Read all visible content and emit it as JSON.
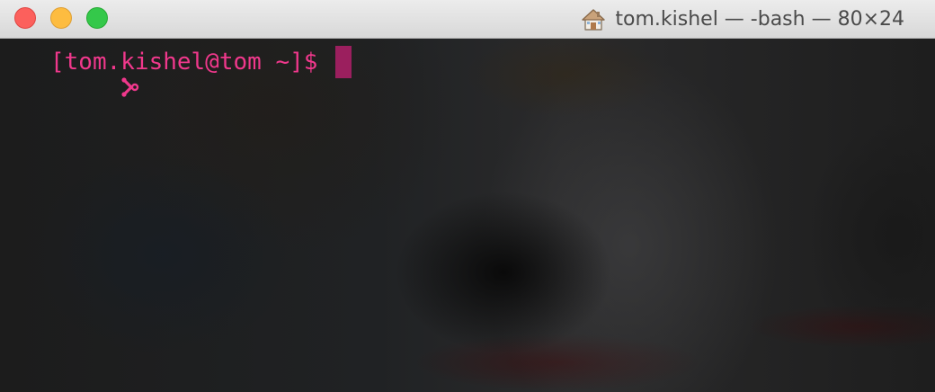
{
  "window": {
    "title": "tom.kishel — -bash — 80×24",
    "title_icon": "home-icon",
    "buttons": {
      "close": "close-button",
      "minimize": "minimize-button",
      "zoom": "zoom-button"
    }
  },
  "terminal": {
    "prompt_icon": "git-branch-icon",
    "prompt_text": "[tom.kishel@tom ~]$",
    "input_value": ""
  },
  "colors": {
    "prompt": "#f0388c",
    "cursor": "#9b1f5e",
    "close": "#fc605c",
    "minimize": "#fdbc40",
    "zoom": "#34c84a"
  }
}
